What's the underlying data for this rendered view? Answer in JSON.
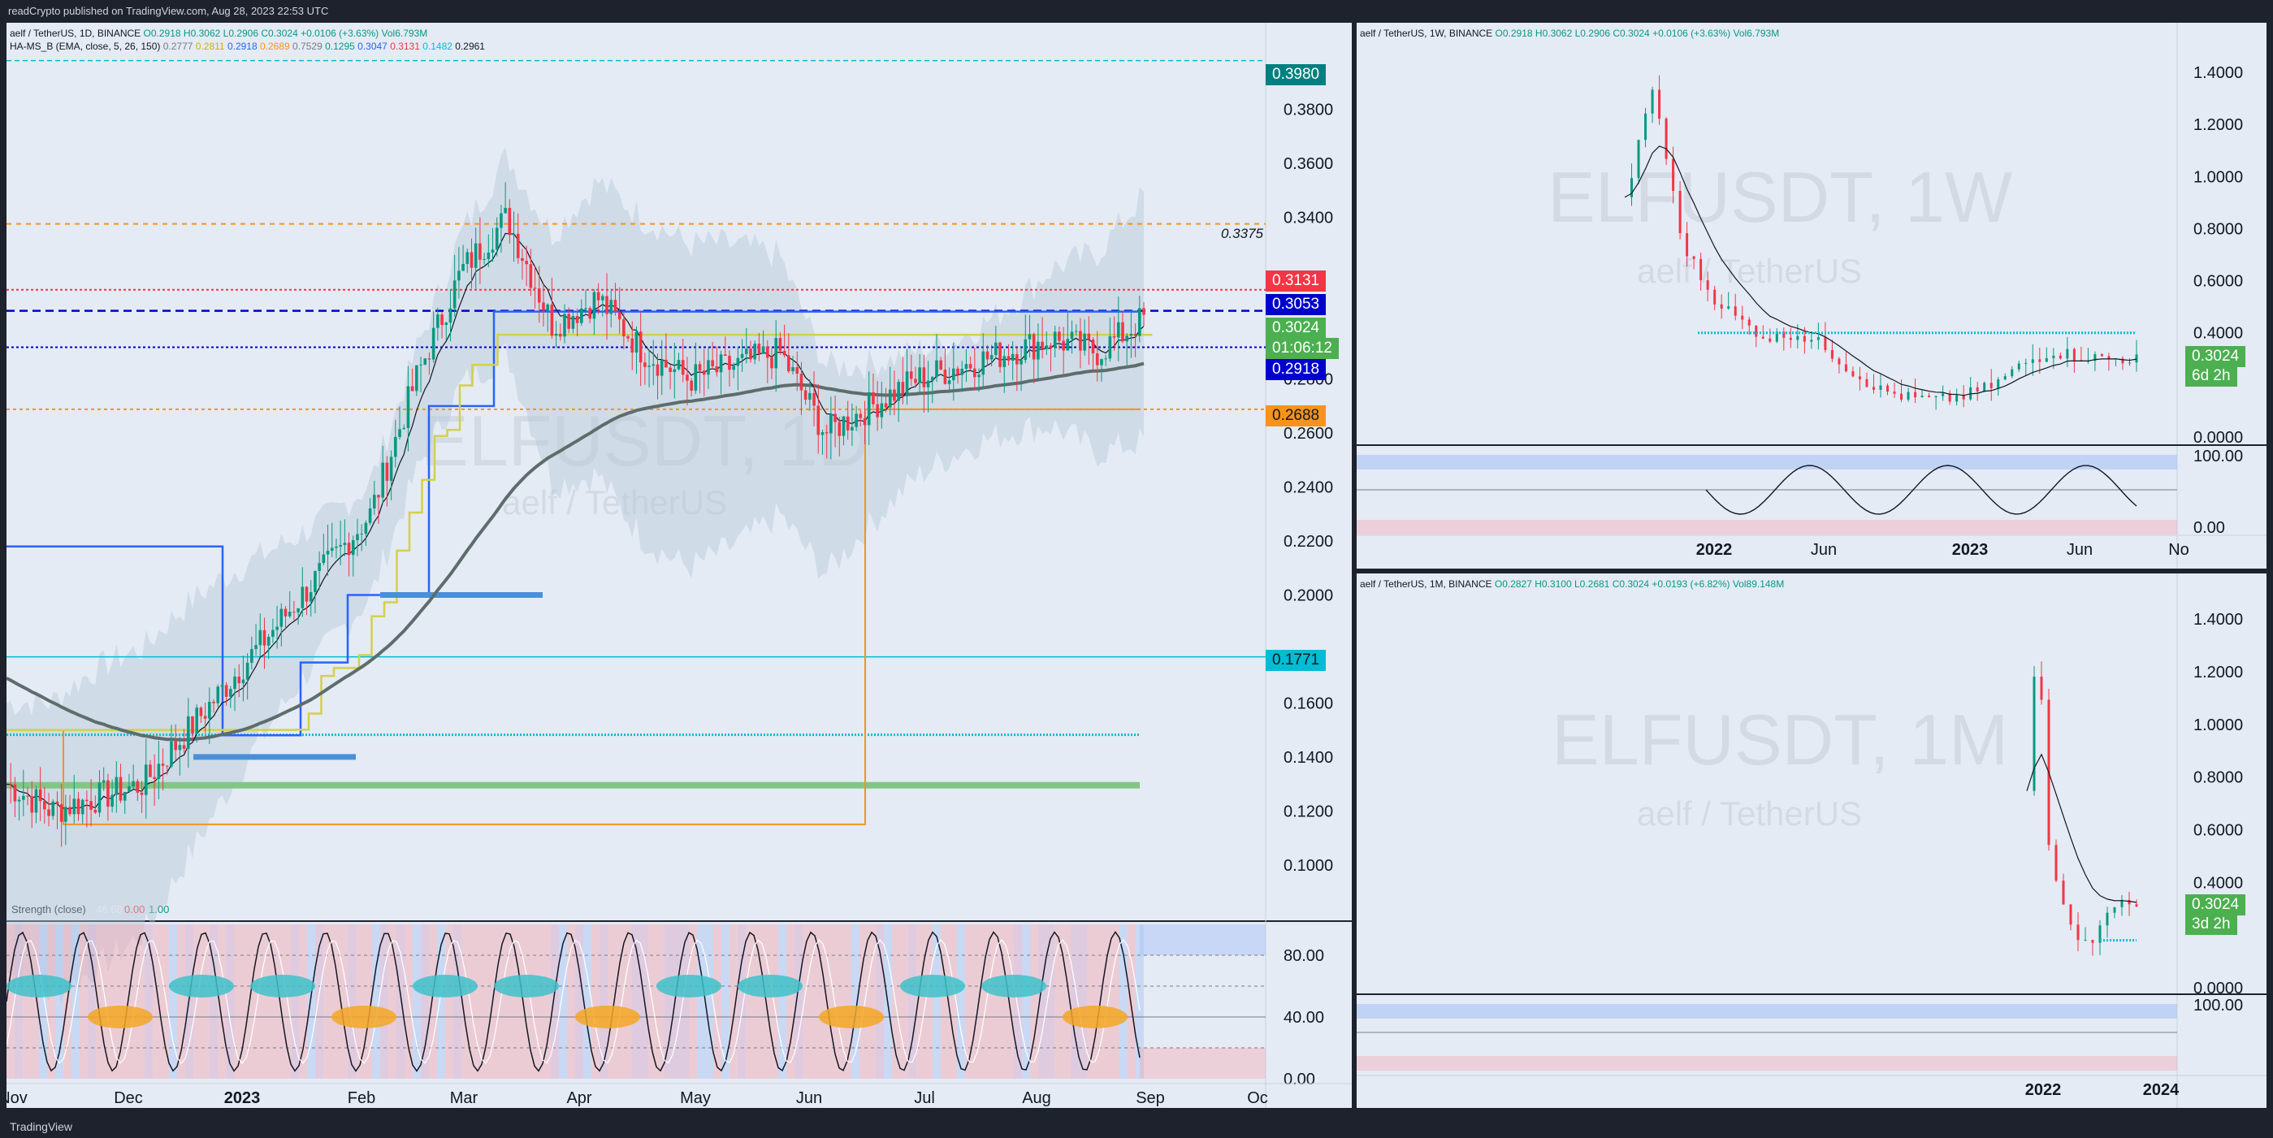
{
  "header": {
    "text": "readCrypto published on TradingView.com, Aug 28, 2023 22:53 UTC"
  },
  "footer": {
    "logo_text": "TradingView"
  },
  "colors": {
    "up": "#089981",
    "down": "#f23645",
    "bg": "#e4ebf5",
    "frame": "#1e222d"
  },
  "main": {
    "legend1": "aelf / TetherUS, 1D, BINANCE",
    "o": "O0.2918",
    "h": "H0.3062",
    "l": "L0.2906",
    "c": "C0.3024",
    "chg": "+0.0106 (+3.63%)",
    "vol": "Vol6.793M",
    "legend2_name": "HA-MS_B (EMA, close, 5, 26, 150)",
    "legend2_vals": [
      "0.2777",
      "0.2811",
      "0.2918",
      "0.2689",
      "0.7529",
      "0.1295",
      "0.3047",
      "0.3131",
      "0.1482",
      "0.2961"
    ],
    "watermark_symbol": "ELFUSDT, 1D",
    "watermark_name": "aelf / TetherUS",
    "line_label_3375": "0.3375",
    "osc_label": "Strength (close)",
    "osc_vals": [
      "46.66",
      "0.00",
      "1.00"
    ],
    "price_ticks": [
      "0.3800",
      "0.3600",
      "0.3400",
      "0.2800",
      "0.2600",
      "0.2400",
      "0.2200",
      "0.2000",
      "0.1600",
      "0.1400",
      "0.1200",
      "0.1000"
    ],
    "osc_ticks": [
      "80.00",
      "40.00",
      "0.00"
    ],
    "time_ticks": [
      "Nov",
      "Dec",
      "2023",
      "Feb",
      "Mar",
      "Apr",
      "May",
      "Jun",
      "Jul",
      "Aug",
      "Sep",
      "Oc"
    ],
    "tags": {
      "t3980": "0.3980",
      "t3131": "0.3131",
      "t3053": "0.3053",
      "t3024": "0.3024",
      "t_countdown": "01:06:12",
      "t2918": "0.2918",
      "t2688": "0.2688",
      "t1771": "0.1771"
    }
  },
  "weekly": {
    "legend": "aelf / TetherUS, 1W, BINANCE",
    "o": "O0.2918",
    "h": "H0.3062",
    "l": "L0.2906",
    "c": "C0.3024",
    "chg": "+0.0106 (+3.63%)",
    "vol": "Vol6.793M",
    "watermark_symbol": "ELFUSDT, 1W",
    "watermark_name": "aelf / TetherUS",
    "price_ticks": [
      "1.4000",
      "1.2000",
      "1.0000",
      "0.8000",
      "0.6000",
      "0.4000",
      "0.0000"
    ],
    "osc_ticks": [
      "100.00",
      "0.00"
    ],
    "time_ticks": [
      "2022",
      "Jun",
      "2023",
      "Jun",
      "No"
    ],
    "tag_price": "0.3024",
    "tag_countdown": "6d 2h"
  },
  "monthly": {
    "legend": "aelf / TetherUS, 1M, BINANCE",
    "o": "O0.2827",
    "h": "H0.3100",
    "l": "L0.2681",
    "c": "C0.3024",
    "chg": "+0.0193 (+6.82%)",
    "vol": "Vol89.148M",
    "watermark_symbol": "ELFUSDT, 1M",
    "watermark_name": "aelf / TetherUS",
    "price_ticks": [
      "1.4000",
      "1.2000",
      "1.0000",
      "0.8000",
      "0.6000",
      "0.4000",
      "0.0000"
    ],
    "osc_ticks": [
      "100.00"
    ],
    "time_ticks": [
      "2022",
      "2024"
    ],
    "tag_price": "0.3024",
    "tag_countdown": "3d 2h"
  },
  "chart_data": [
    {
      "type": "candlestick",
      "title": "aelf / TetherUS, 1D, BINANCE",
      "x": [
        "Nov",
        "Dec",
        "2023",
        "Feb",
        "Mar",
        "Apr",
        "May",
        "Jun",
        "Jul",
        "Aug",
        "Sep"
      ],
      "close_series": [
        0.13,
        0.12,
        0.125,
        0.13,
        0.15,
        0.17,
        0.19,
        0.21,
        0.23,
        0.28,
        0.32,
        0.34,
        0.3,
        0.31,
        0.29,
        0.28,
        0.285,
        0.29,
        0.26,
        0.27,
        0.28,
        0.285,
        0.29,
        0.295,
        0.29,
        0.3024
      ],
      "levels": [
        0.398,
        0.3375,
        0.3131,
        0.3053,
        0.2918,
        0.2688,
        0.1771,
        0.1482
      ],
      "ylim": [
        0.09,
        0.4
      ],
      "last": 0.3024
    },
    {
      "type": "candlestick",
      "title": "aelf / TetherUS, 1W, BINANCE",
      "x": [
        "2022",
        "Jun",
        "2023",
        "Jun"
      ],
      "close_series": [
        0.9,
        1.35,
        0.75,
        0.55,
        0.45,
        0.38,
        0.4,
        0.35,
        0.25,
        0.18,
        0.15,
        0.14,
        0.16,
        0.2,
        0.28,
        0.33,
        0.31,
        0.3,
        0.3024
      ],
      "ylim": [
        0.0,
        1.45
      ],
      "last": 0.3024
    },
    {
      "type": "candlestick",
      "title": "aelf / TetherUS, 1M, BINANCE",
      "x": [
        "2022",
        "2024"
      ],
      "close_series": [
        0.75,
        1.38,
        0.55,
        0.35,
        0.25,
        0.18,
        0.16,
        0.28,
        0.33,
        0.31,
        0.3024
      ],
      "ylim": [
        0.0,
        1.45
      ],
      "last": 0.3024
    }
  ]
}
